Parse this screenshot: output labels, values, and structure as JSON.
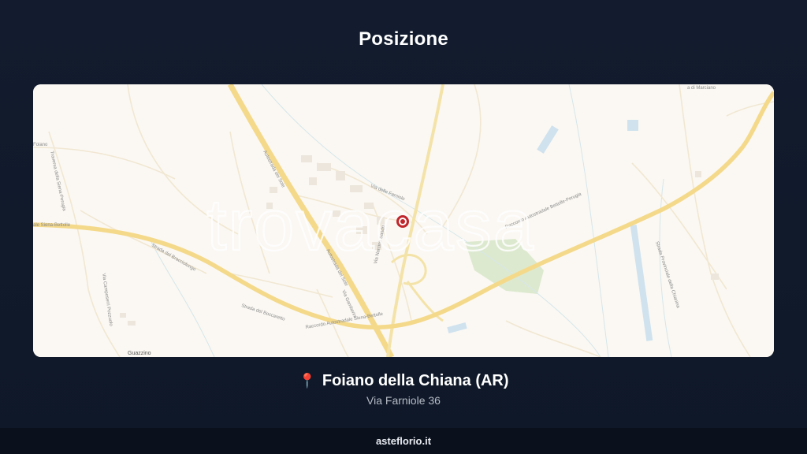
{
  "page": {
    "title": "Posizione"
  },
  "map": {
    "watermark": "trovacasa",
    "place_labels": {
      "guazzino": "Guazzino",
      "foiano": "Foiano",
      "marciano": "a di Marciano"
    },
    "road_labels": {
      "autostrada_1": "Autostrada del Sole",
      "autostrada_2": "Autostrada del Sole",
      "raccordo_1": "Raccordo Autostradale Siena-Bettolle",
      "raccordo_2": "Raccordo Autostradale Bettolle-Perugia",
      "siena_bettolle": "ale Siena-Bettolle",
      "strada_bracciolungo": "Strada del Bracciolungo",
      "strada_boccaretto": "Strada del Boccaretto",
      "via_farniole": "Via delle Farniole",
      "via_gamberini": "Via Gamberini",
      "via_narciso": "Via Narciso Sandri",
      "via_capanne": "Via Camposerri Pozzuolo",
      "traversa_perugia": "Traversa della Siena-Perugia",
      "strada_chiana": "Strada Provinciale della Chianina"
    },
    "marker_icon": "location-pin-icon"
  },
  "location": {
    "pin_icon": "round-pushpin-icon",
    "city": "Foiano della Chiana (AR)",
    "address": "Via Farniole 36"
  },
  "footer": {
    "site": "asteflorio.it"
  }
}
